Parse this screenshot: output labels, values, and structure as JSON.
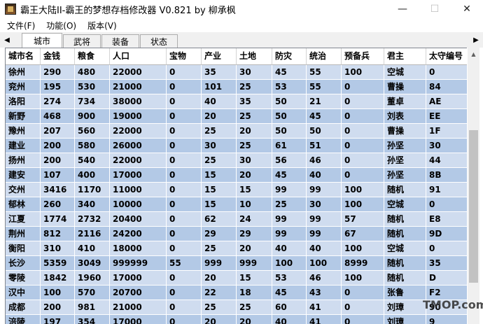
{
  "window": {
    "title": "霸王大陆II-霸王的梦想存档修改器 V0.821 by 柳承枫",
    "minimize": "—",
    "maximize": "☐",
    "close": "✕"
  },
  "menu": [
    "文件(F)",
    "功能(O)",
    "版本(V)"
  ],
  "tabs": [
    {
      "label": "城市",
      "active": true
    },
    {
      "label": "武将",
      "active": false
    },
    {
      "label": "装备",
      "active": false
    },
    {
      "label": "状态",
      "active": false
    }
  ],
  "tab_scroll": {
    "left": "◀",
    "right": "▶"
  },
  "scroll_up": "▲",
  "table": {
    "columns": [
      "城市名",
      "金钱",
      "粮食",
      "人口",
      "宝物",
      "产业",
      "土地",
      "防灾",
      "统治",
      "预备兵",
      "君主",
      "太守编号"
    ],
    "rows": [
      [
        "徐州",
        "290",
        "480",
        "22000",
        "0",
        "35",
        "30",
        "45",
        "55",
        "100",
        "空城",
        "0"
      ],
      [
        "兖州",
        "195",
        "530",
        "21000",
        "0",
        "101",
        "25",
        "53",
        "55",
        "0",
        "曹操",
        "84"
      ],
      [
        "洛阳",
        "274",
        "734",
        "38000",
        "0",
        "40",
        "35",
        "50",
        "21",
        "0",
        "董卓",
        "AE"
      ],
      [
        "新野",
        "468",
        "900",
        "19000",
        "0",
        "20",
        "25",
        "50",
        "45",
        "0",
        "刘表",
        "EE"
      ],
      [
        "豫州",
        "207",
        "560",
        "22000",
        "0",
        "25",
        "20",
        "50",
        "50",
        "0",
        "曹操",
        "1F"
      ],
      [
        "建业",
        "200",
        "580",
        "26000",
        "0",
        "30",
        "25",
        "61",
        "51",
        "0",
        "孙坚",
        "30"
      ],
      [
        "扬州",
        "200",
        "540",
        "22000",
        "0",
        "25",
        "30",
        "56",
        "46",
        "0",
        "孙坚",
        "44"
      ],
      [
        "建安",
        "107",
        "400",
        "17000",
        "0",
        "15",
        "20",
        "45",
        "40",
        "0",
        "孙坚",
        "8B"
      ],
      [
        "交州",
        "3416",
        "1170",
        "11000",
        "0",
        "15",
        "15",
        "99",
        "99",
        "100",
        "随机",
        "91"
      ],
      [
        "郁林",
        "260",
        "340",
        "10000",
        "0",
        "15",
        "10",
        "25",
        "30",
        "100",
        "空城",
        "0"
      ],
      [
        "江夏",
        "1774",
        "2732",
        "20400",
        "0",
        "62",
        "24",
        "99",
        "99",
        "57",
        "随机",
        "E8"
      ],
      [
        "荆州",
        "812",
        "2116",
        "24200",
        "0",
        "29",
        "29",
        "99",
        "99",
        "67",
        "随机",
        "9D"
      ],
      [
        "衡阳",
        "310",
        "410",
        "18000",
        "0",
        "25",
        "20",
        "40",
        "40",
        "100",
        "空城",
        "0"
      ],
      [
        "长沙",
        "5359",
        "3049",
        "999999",
        "55",
        "999",
        "999",
        "100",
        "100",
        "8999",
        "随机",
        "35"
      ],
      [
        "零陵",
        "1842",
        "1960",
        "17000",
        "0",
        "20",
        "15",
        "53",
        "46",
        "100",
        "随机",
        "D"
      ],
      [
        "汉中",
        "100",
        "570",
        "20700",
        "0",
        "22",
        "18",
        "45",
        "43",
        "0",
        "张鲁",
        "F2"
      ],
      [
        "成都",
        "200",
        "981",
        "21000",
        "0",
        "25",
        "25",
        "60",
        "41",
        "0",
        "刘璋",
        "90"
      ],
      [
        "涪陵",
        "197",
        "354",
        "17000",
        "0",
        "20",
        "20",
        "40",
        "41",
        "0",
        "刘璋",
        "9"
      ]
    ]
  },
  "watermark": "TMOP.com"
}
